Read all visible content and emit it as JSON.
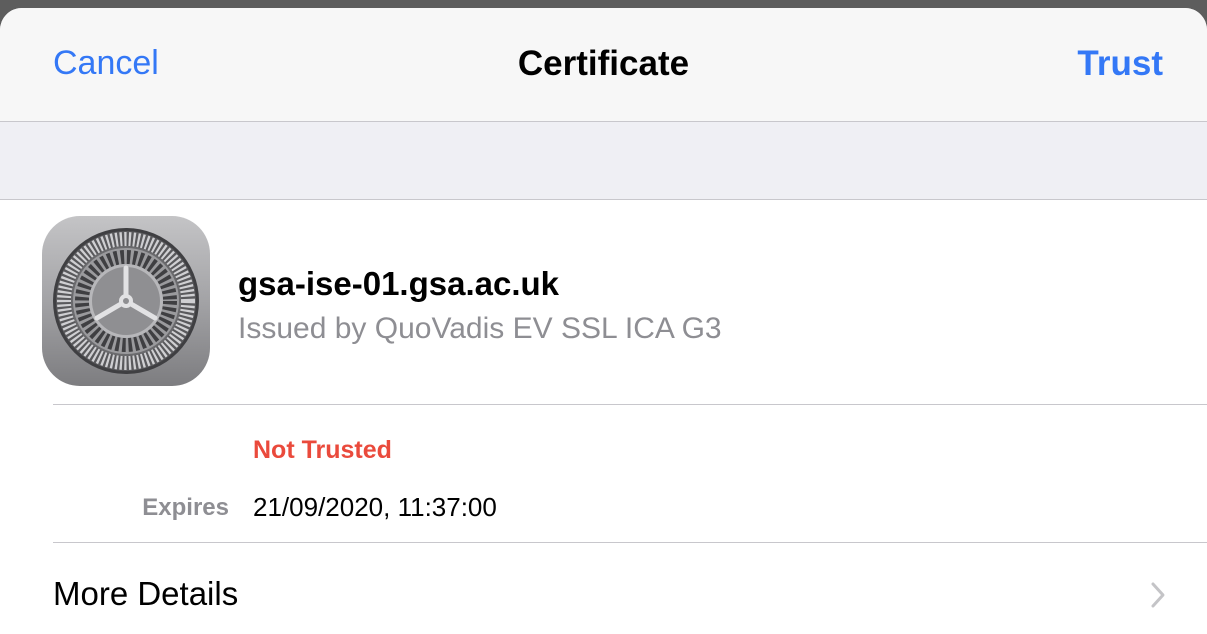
{
  "navbar": {
    "cancel_label": "Cancel",
    "title": "Certificate",
    "trust_label": "Trust"
  },
  "certificate": {
    "icon": "settings-gear-icon",
    "name": "gsa-ise-01.gsa.ac.uk",
    "issuer": "Issued by QuoVadis EV SSL ICA G3",
    "trust_status": "Not Trusted",
    "expires_label": "Expires",
    "expires_value": "21/09/2020, 11:37:00"
  },
  "more_details": {
    "label": "More Details",
    "icon": "chevron-right-icon"
  },
  "colors": {
    "accent": "#3478f6",
    "warning": "#ea4a3c",
    "secondary_text": "#8e8e93"
  }
}
